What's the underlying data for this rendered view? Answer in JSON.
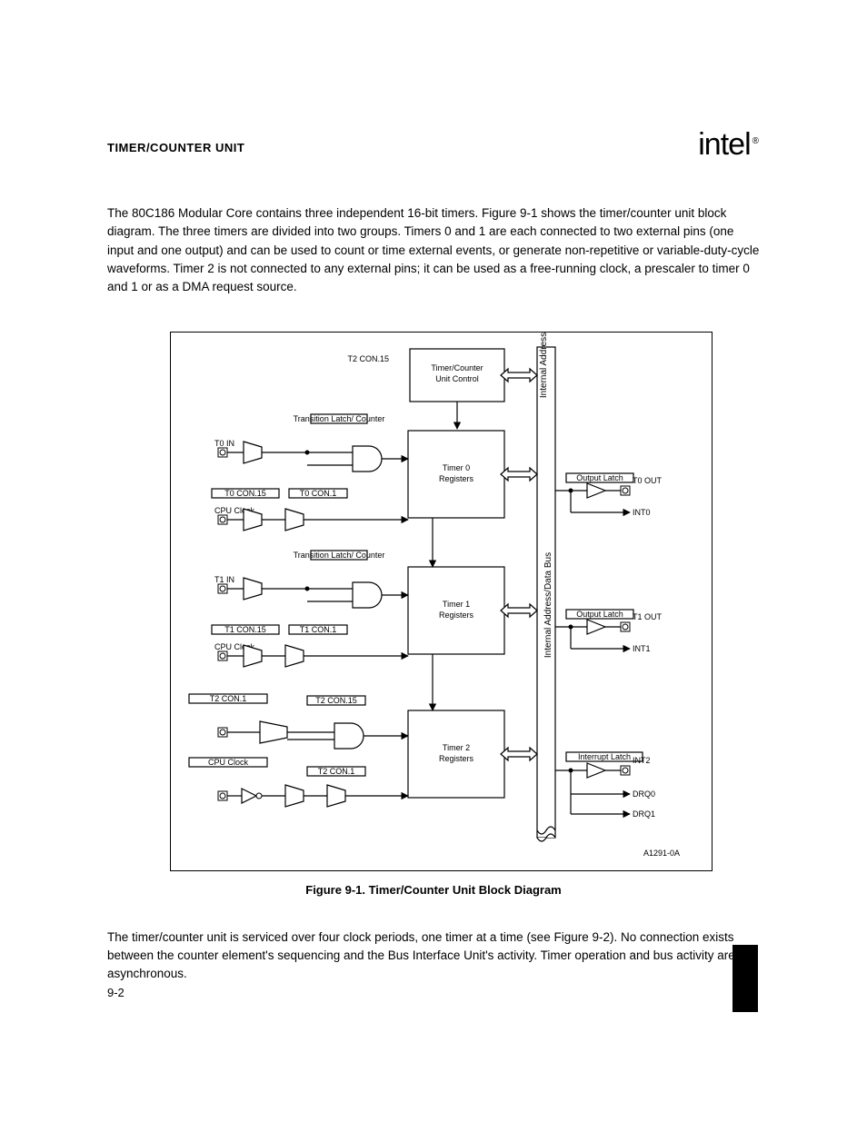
{
  "header": {
    "title": "TIMER/COUNTER UNIT"
  },
  "brand": {
    "name": "intel",
    "registered": "®"
  },
  "intro": {
    "p1": "The 80C186 Modular Core contains three independent 16-bit timers. Figure 9-1 shows the timer/counter unit block diagram. The three timers are divided into two groups. Timers 0 and 1 are each connected to two external pins (one input and one output) and can be used to count or time external events, or generate non-repetitive or variable-duty-cycle waveforms. Timer 2 is not connected to any external pins; it can be used as a free-running clock, a prescaler to timer 0 and 1 or as a DMA request source."
  },
  "figure": {
    "caption": "Figure 9-1.  Timer/Counter Unit Block Diagram",
    "labels": {
      "bus": "Internal Address/Data Bus",
      "tcu_ctrl": "T2 CON.15",
      "tcu": {
        "line1": "Timer/Counter",
        "line2": "Unit Control"
      },
      "reg0": {
        "line1": "Timer 0",
        "line2": "Registers"
      },
      "reg1": {
        "line1": "Timer 1",
        "line2": "Registers"
      },
      "reg2": {
        "line1": "Timer 2",
        "line2": "Registers"
      },
      "int_latch": "Interrupt Latch",
      "in0": "T0 IN",
      "in1": "T1 IN",
      "out0": "T0 OUT",
      "out1": "T1 OUT",
      "out_int0": "INT0",
      "out_int1": "INT1",
      "tc0": "T0 CON.15",
      "tc0b": "T0 CON.1",
      "tc1": "T1 CON.15",
      "tc1b": "T1 CON.1",
      "tc2": "T2 CON.1",
      "trans": "Transition Latch/ Counter",
      "clk": "CPU Clock",
      "clk2": "CPU Clock",
      "clk3": "CPU Clock",
      "out_row0": {
        "line1": "Output Latch",
        "int": "INT0"
      },
      "out_row1": {
        "line1": "Output Latch",
        "int": "INT1"
      },
      "out_row2": {
        "line1": "Interrupt Latch",
        "int": "INT2",
        "drq0": "DRQ0",
        "drq1": "DRQ1"
      },
      "part": "A1291-0A"
    }
  },
  "after": {
    "p1": "The timer/counter unit is serviced over four clock periods, one timer at a time (see Figure 9-2). No connection exists between the counter element's sequencing and the Bus Interface Unit's activity. Timer operation and bus activity are asynchronous."
  },
  "pagenum": "9-2"
}
